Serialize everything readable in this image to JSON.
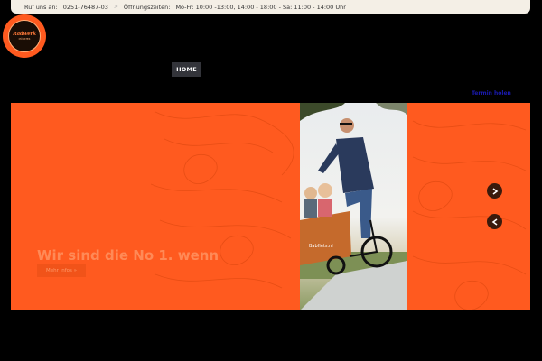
{
  "topbar": {
    "call_label": "Ruf uns an:",
    "phone": "0251-76487-03",
    "hours_label": "Öffnungszeiten:",
    "hours": "Mo-Fr: 10:00 -13:00, 14:00 - 18:00 - Sa: 11:00 - 14:00 Uhr"
  },
  "logo": {
    "name": "Radwerk",
    "tagline": "MÜNSTER"
  },
  "nav": {
    "home_label": "HOME"
  },
  "secondary_link": "Termin holen",
  "hero": {
    "title": "Wir sind die No 1. wenn",
    "button_label": "Mehr Infos »",
    "photo_sign": "Babfiets.nl"
  },
  "colors": {
    "accent": "#ff5a1f",
    "dark": "#33343a",
    "background": "#000000"
  },
  "icons": {
    "next": "chevron-right-icon",
    "prev": "chevron-left-icon"
  }
}
